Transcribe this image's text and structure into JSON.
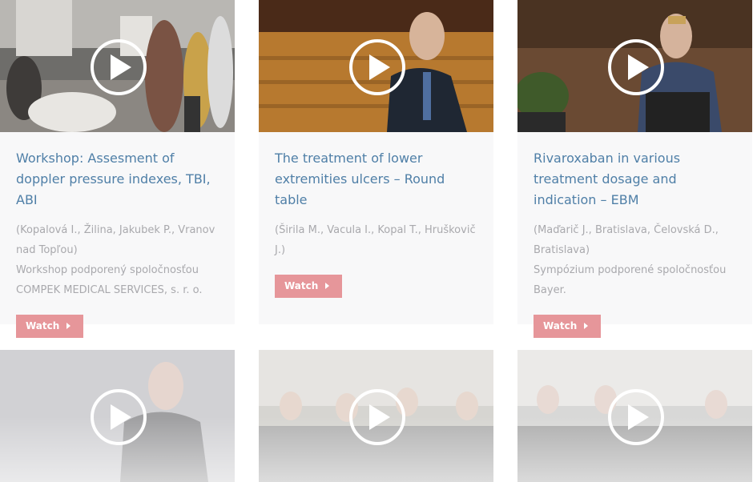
{
  "cards": [
    {
      "title": "Workshop: Assesment of doppler pressure indexes, TBI, ABI",
      "authors": "(Kopalová I., Žilina, Jakubek P., Vranov nad Topľou)",
      "sponsor": "Workshop podporený spoločnosťou COMPEK MEDICAL SERVICES, s. r. o.",
      "button": "Watch"
    },
    {
      "title": "The treatment of lower extremities ulcers – Round table",
      "authors": "(Širila M., Vacula I., Kopal T., Hruškovič J.)",
      "sponsor": "",
      "button": "Watch"
    },
    {
      "title": "Rivaroxaban in various treatment dosage and indication – EBM",
      "authors": "(Maďarič J., Bratislava, Čelovská D., Bratislava)",
      "sponsor": "Sympózium podporené spoločnosťou Bayer.",
      "button": "Watch"
    }
  ],
  "colors": {
    "title": "#4f7fa7",
    "meta": "#a9a9ad",
    "button": "#e6969a",
    "card_bg": "#f8f8f9"
  },
  "icons": {
    "play": "play-circle-icon",
    "chevron": "chevron-right-icon"
  }
}
